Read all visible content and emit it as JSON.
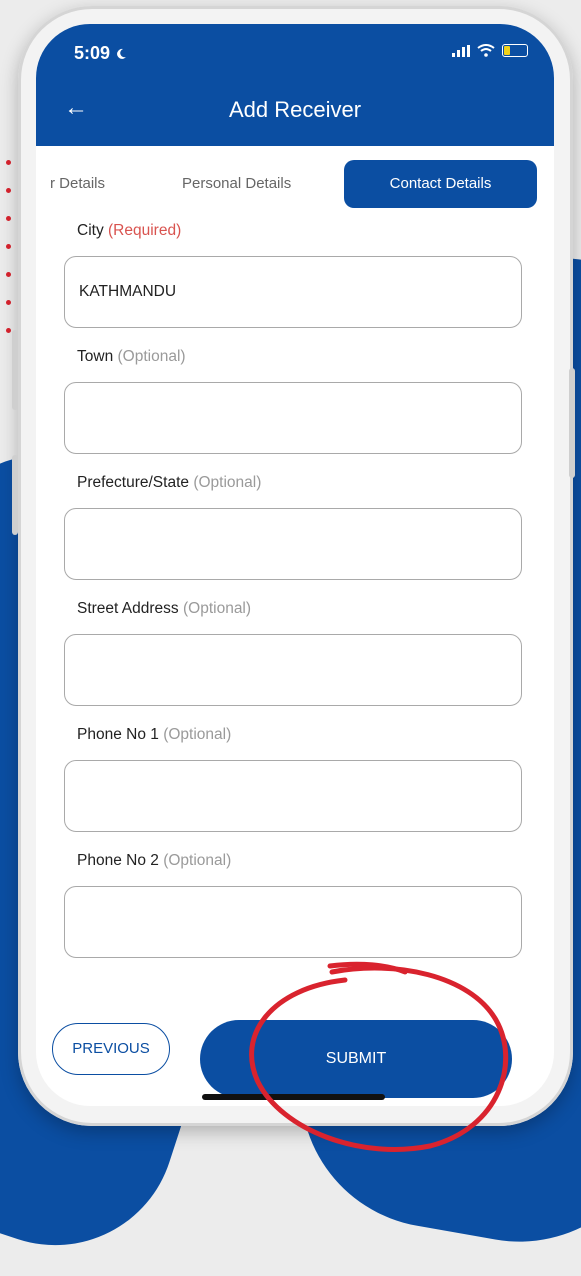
{
  "status": {
    "time": "5:09"
  },
  "header": {
    "title": "Add Receiver"
  },
  "tabs": [
    {
      "label": "r Details"
    },
    {
      "label": "Personal Details"
    },
    {
      "label": "Contact Details"
    }
  ],
  "fields": [
    {
      "label": "City",
      "tag": "(Required)",
      "value": "KATHMANDU"
    },
    {
      "label": "Town",
      "tag": "(Optional)",
      "value": ""
    },
    {
      "label": "Prefecture/State",
      "tag": "(Optional)",
      "value": ""
    },
    {
      "label": "Street Address",
      "tag": "(Optional)",
      "value": ""
    },
    {
      "label": "Phone No 1",
      "tag": "(Optional)",
      "value": ""
    },
    {
      "label": "Phone No 2",
      "tag": "(Optional)",
      "value": ""
    }
  ],
  "buttons": {
    "previous": "PREVIOUS",
    "submit": "SUBMIT"
  },
  "colors": {
    "primary": "#0b4ea2",
    "required": "#d9534f",
    "annotation": "#d9232e"
  }
}
